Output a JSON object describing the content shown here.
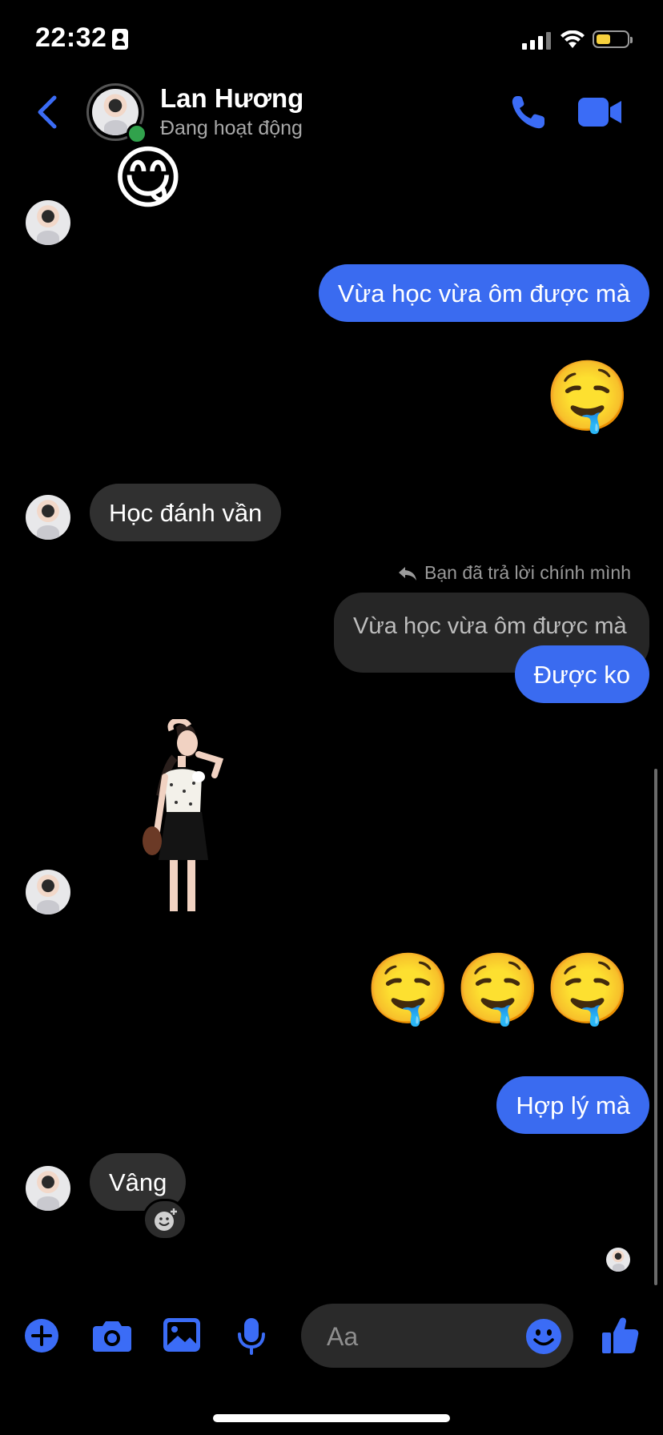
{
  "status_bar": {
    "time": "22:32"
  },
  "header": {
    "name": "Lan Hương",
    "status": "Đang hoạt động"
  },
  "messages": {
    "top_emoji": "😋",
    "m1": "Vừa học vừa ôm được mà",
    "m2_emoji": "🤤",
    "m3": "Học đánh vần",
    "reply_note": "Bạn đã trả lời chính mình",
    "quoted": "Vừa học vừa ôm được mà",
    "m4": "Được ko",
    "m6_emojis": [
      "🤤",
      "🤤",
      "🤤"
    ],
    "m7": "Hợp lý mà",
    "m8": "Vâng"
  },
  "composer": {
    "placeholder": "Aa"
  },
  "colors": {
    "accent": "#3a6bf0",
    "icon_blue": "#3b6cf6",
    "incoming_bubble": "#303030",
    "online": "#31a24c",
    "battery": "#f7d13d"
  },
  "icons": [
    "back-arrow-icon",
    "phone-icon",
    "video-camera-icon",
    "plus-icon",
    "camera-icon",
    "image-icon",
    "microphone-icon",
    "emoji-icon",
    "thumbs-up-icon",
    "reply-arrow-icon",
    "add-reaction-icon"
  ]
}
